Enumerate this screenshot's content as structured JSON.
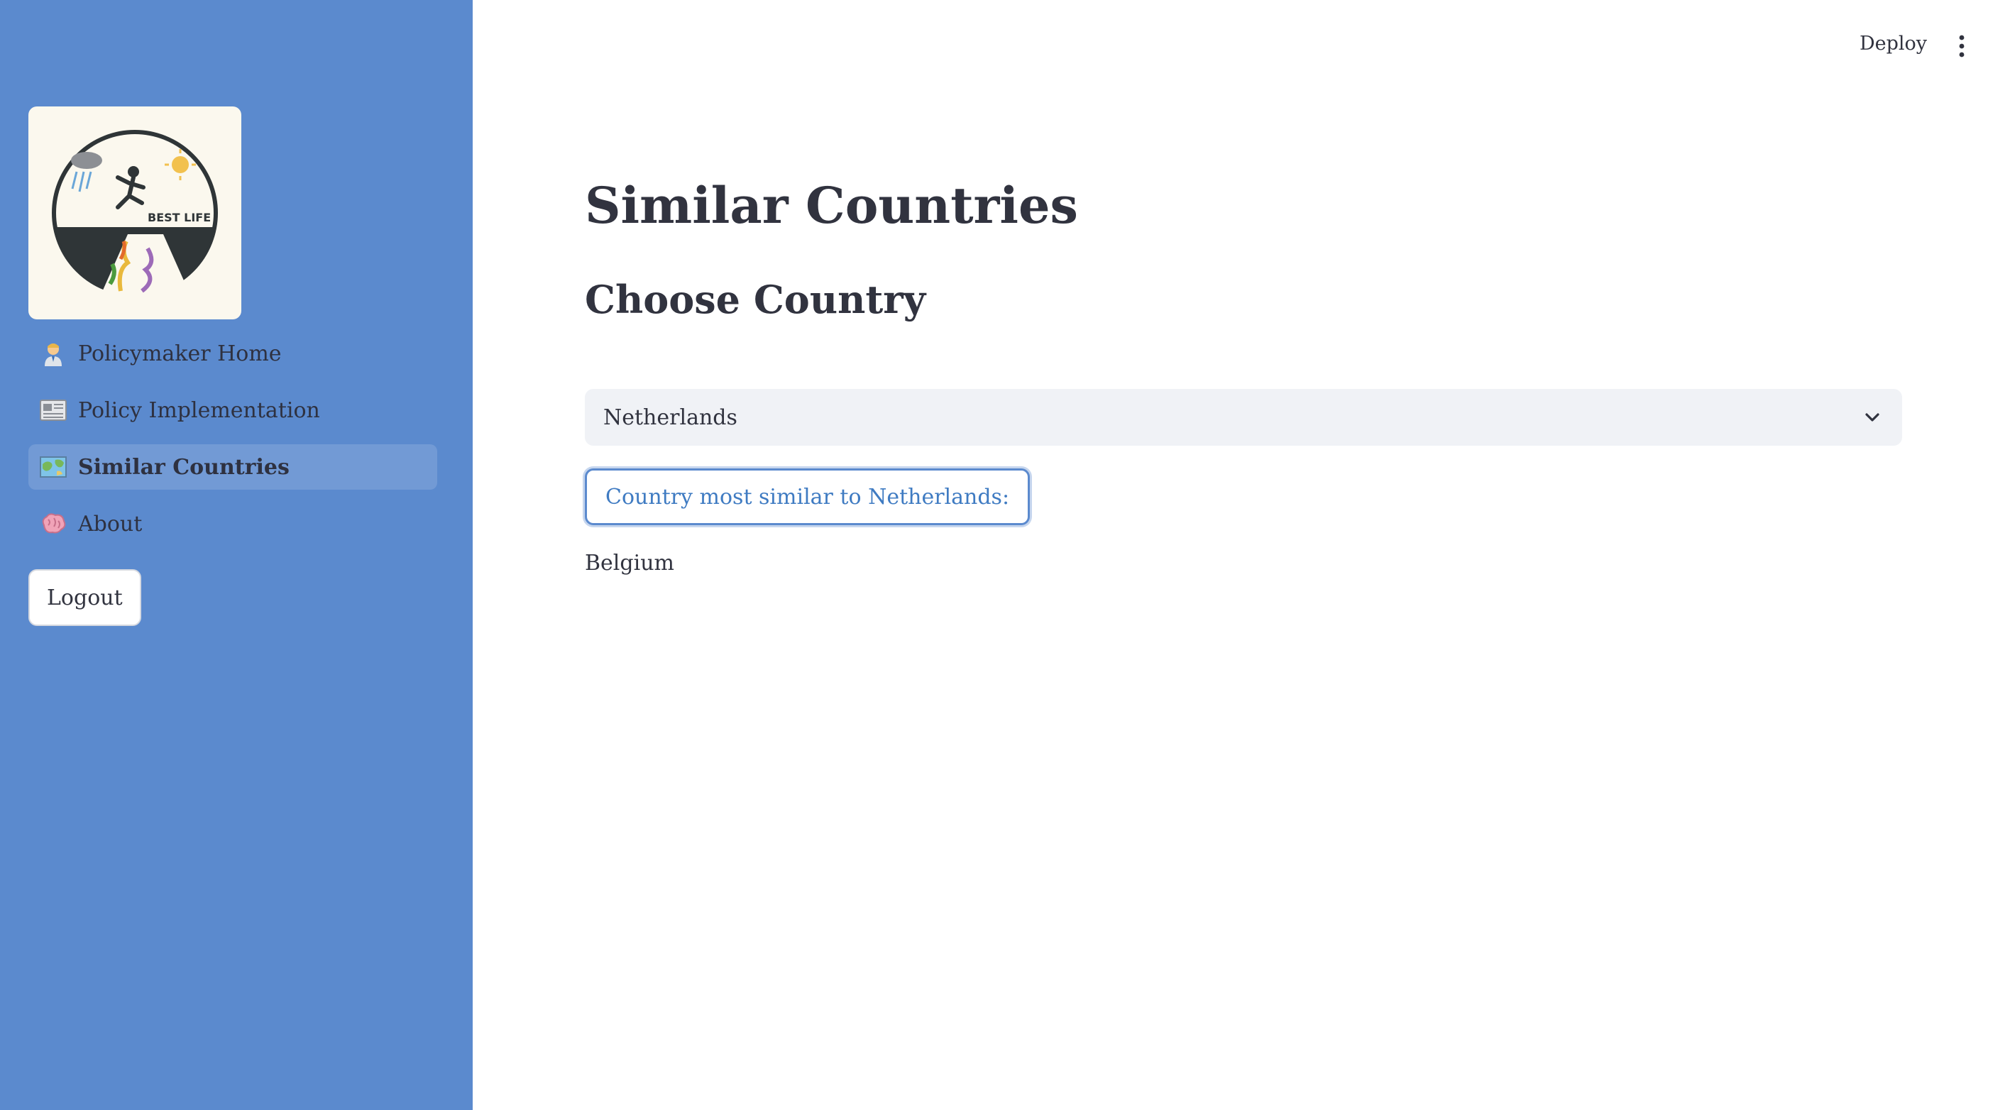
{
  "header": {
    "deploy_label": "Deploy",
    "menu_icon": "kebab-menu-icon"
  },
  "sidebar": {
    "logo": {
      "icon": "best-life-logo",
      "text": "BEST LIFE"
    },
    "items": [
      {
        "label": "Policymaker Home",
        "icon": "policymaker-emoji-icon",
        "active": false
      },
      {
        "label": "Policy Implementation",
        "icon": "newspaper-emoji-icon",
        "active": false
      },
      {
        "label": "Similar Countries",
        "icon": "map-emoji-icon",
        "active": true
      },
      {
        "label": "About",
        "icon": "brain-emoji-icon",
        "active": false
      }
    ],
    "logout_label": "Logout"
  },
  "main": {
    "title": "Similar Countries",
    "subtitle": "Choose Country",
    "select": {
      "value": "Netherlands",
      "icon": "chevron-down-icon"
    },
    "result_button_label": "Country most similar to Netherlands:",
    "result_value": "Belgium"
  },
  "colors": {
    "sidebar_bg": "#5b8ace",
    "accent": "#3f7bc2",
    "text": "#31333f",
    "select_bg": "#f0f2f6"
  }
}
